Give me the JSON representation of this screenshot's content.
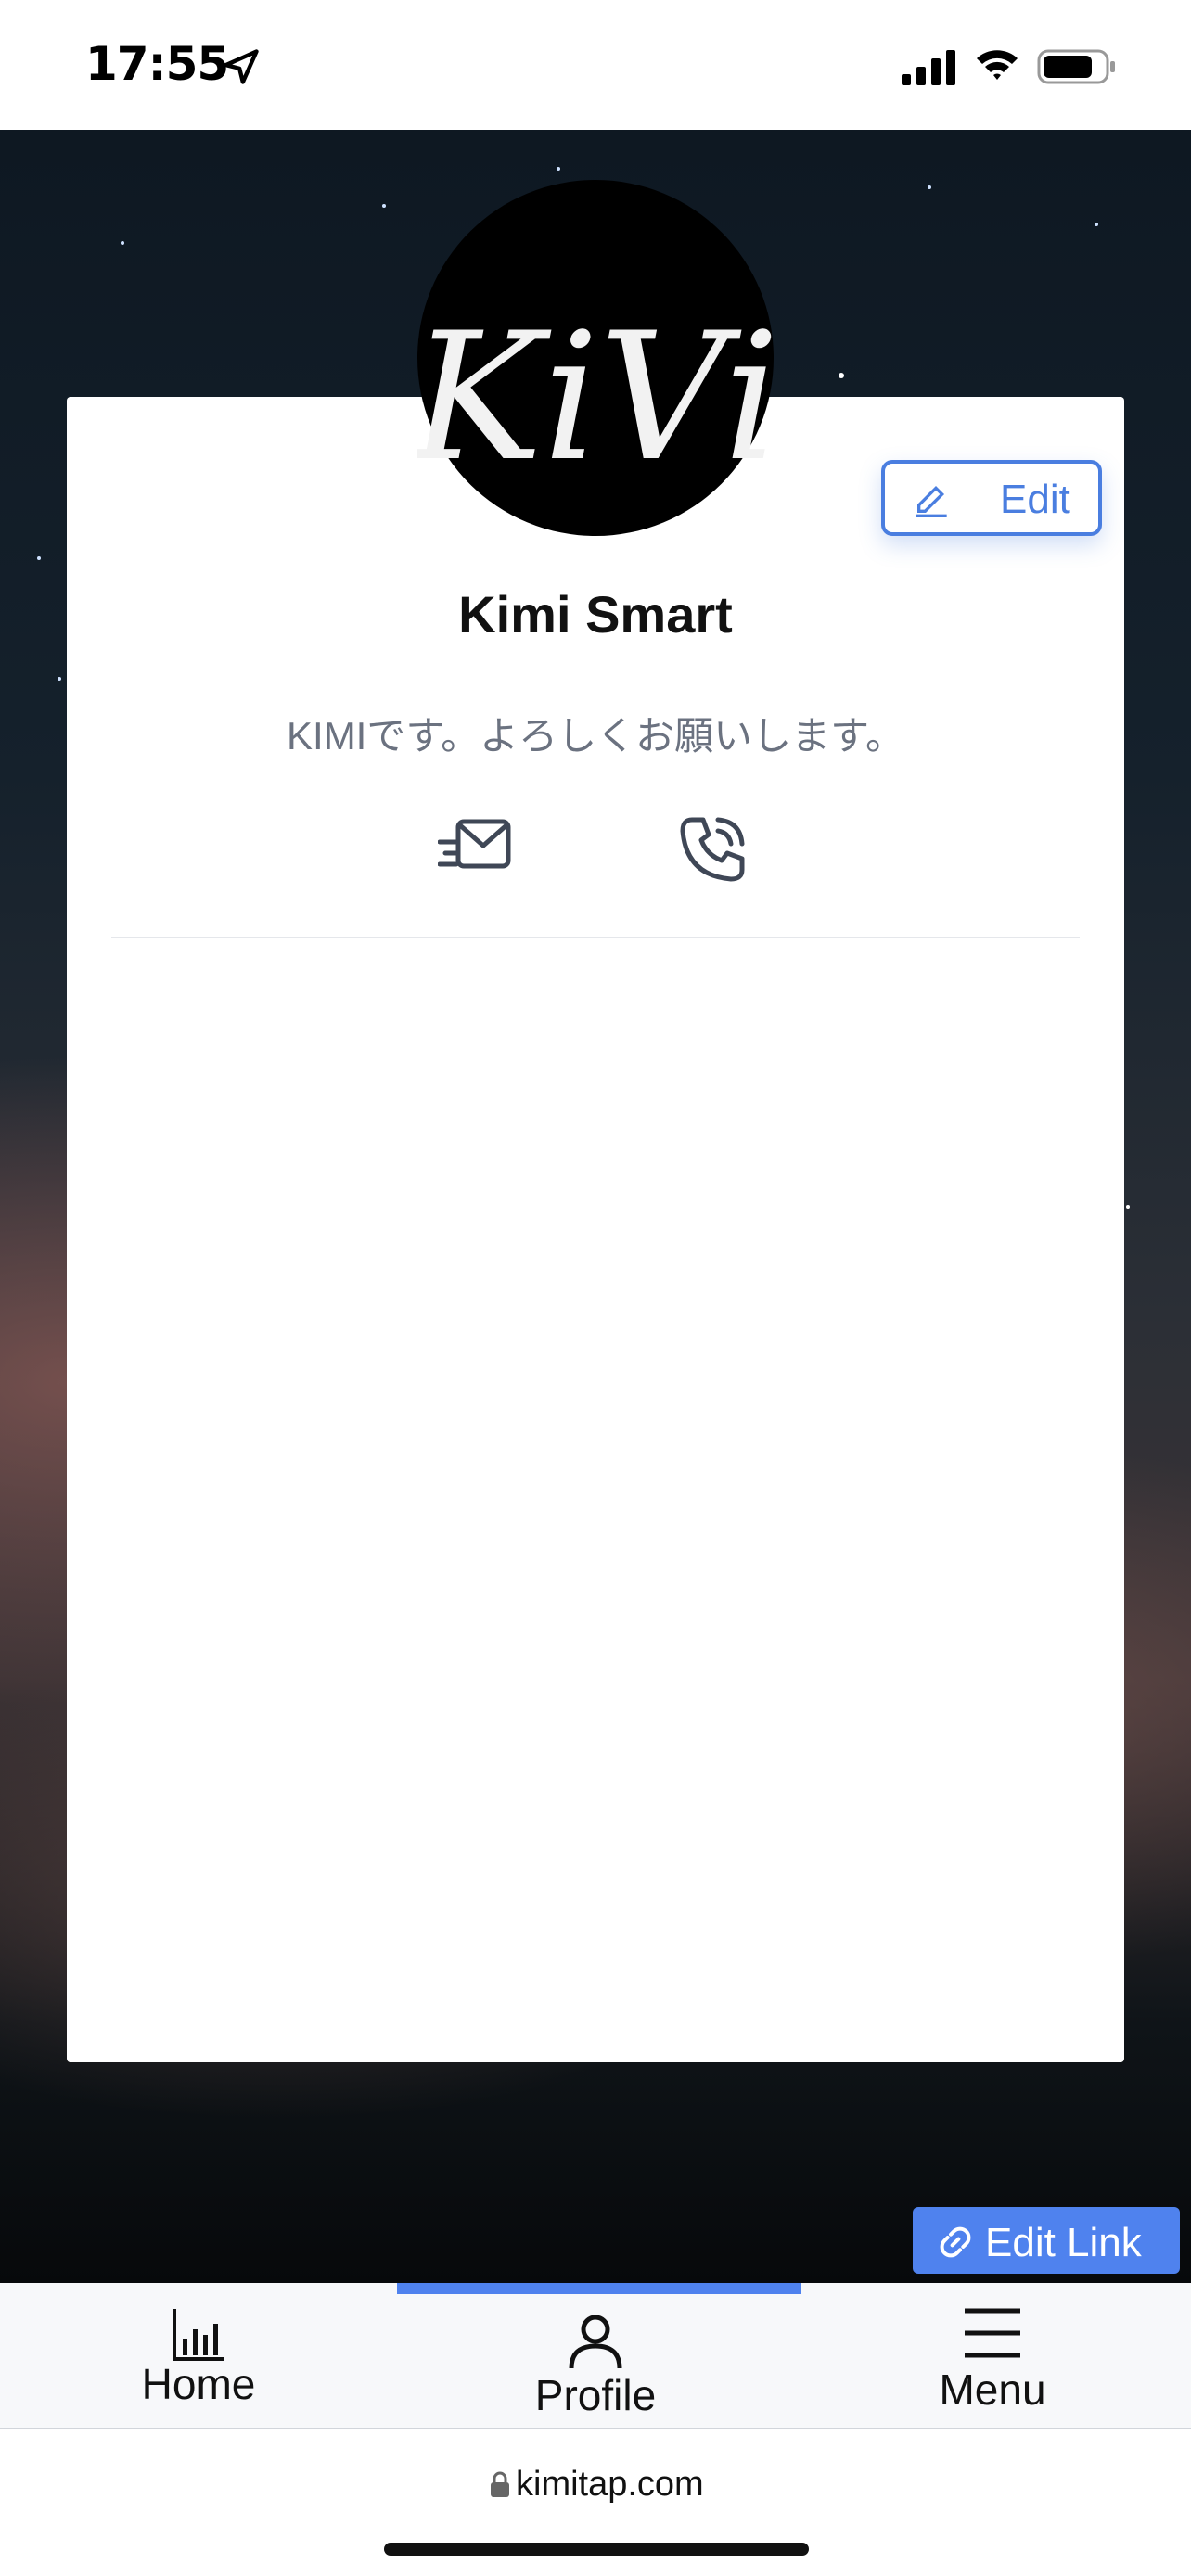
{
  "status_bar": {
    "time": "17:55",
    "icons": [
      "location-arrow-icon",
      "signal-icon",
      "wifi-icon",
      "battery-icon"
    ]
  },
  "profile": {
    "logo_text": "KiVi",
    "name": "Kimi Smart",
    "bio": "KIMIです。よろしくお願いします。",
    "edit_label": "Edit",
    "contact_icons": [
      "mail-icon",
      "phone-icon"
    ]
  },
  "actions": {
    "edit_link_label": "Edit Link"
  },
  "bottom_nav": {
    "items": [
      {
        "label": "Home",
        "icon": "bar-chart-icon"
      },
      {
        "label": "Profile",
        "icon": "user-icon",
        "active": true
      },
      {
        "label": "Menu",
        "icon": "hamburger-icon"
      }
    ]
  },
  "browser": {
    "url": "kimitap.com"
  },
  "colors": {
    "accent": "#4f82ee",
    "edit_outline": "#4a7ee0",
    "bio_text": "#6b7280"
  }
}
